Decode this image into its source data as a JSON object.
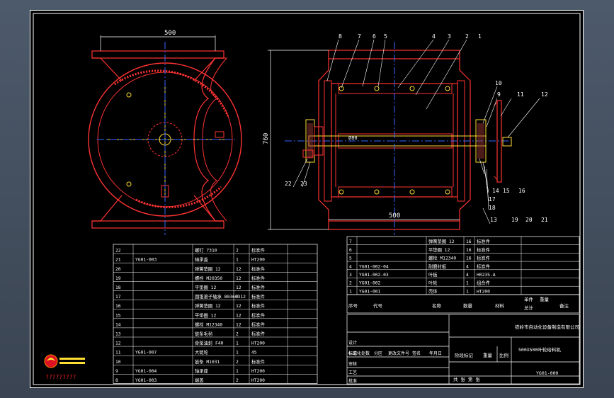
{
  "dims": {
    "width_top": "500",
    "height_left": "760",
    "width_bottom": "500",
    "shaft": "Ø80"
  },
  "balloons": [
    "8",
    "7",
    "6",
    "5",
    "4",
    "3",
    "2",
    "1",
    "10",
    "9",
    "11",
    "12",
    "13",
    "14",
    "15",
    "16",
    "17",
    "18",
    "19",
    "20",
    "21",
    "22",
    "23"
  ],
  "parts_left": [
    {
      "no": "22",
      "code": "",
      "name": "螺钉 7310",
      "qty": "2",
      "mat": "标准件"
    },
    {
      "no": "21",
      "code": "YG01-003",
      "name": "轴承盖",
      "qty": "1",
      "mat": "HT200"
    },
    {
      "no": "20",
      "code": "",
      "name": "弹簧垫圈 12",
      "qty": "12",
      "mat": "标准件"
    },
    {
      "no": "19",
      "code": "",
      "name": "螺栓 M20350",
      "qty": "12",
      "mat": "标准件"
    },
    {
      "no": "18",
      "code": "",
      "name": "平垫圈 12",
      "qty": "12",
      "mat": "标准件"
    },
    {
      "no": "17",
      "code": "",
      "name": "圆锥滚子轴承 80360312",
      "qty": "2",
      "mat": "标准件"
    },
    {
      "no": "16",
      "code": "",
      "name": "弹簧垫圈 12",
      "qty": "12",
      "mat": "标准件"
    },
    {
      "no": "15",
      "code": "",
      "name": "平垫圈 12",
      "qty": "12",
      "mat": "标准件"
    },
    {
      "no": "14",
      "code": "",
      "name": "螺栓 M12340",
      "qty": "12",
      "mat": "标准件"
    },
    {
      "no": "13",
      "code": "",
      "name": "链条毛毡",
      "qty": "2",
      "mat": "标准件"
    },
    {
      "no": "12",
      "code": "",
      "name": "骨架油封 F40",
      "qty": "1",
      "mat": "HT200"
    },
    {
      "no": "11",
      "code": "YG01-007",
      "name": "大链轮",
      "qty": "1",
      "mat": "45"
    },
    {
      "no": "10",
      "code": "",
      "name": "链条 M1031",
      "qty": "2",
      "mat": "标准件"
    },
    {
      "no": "9",
      "code": "YG01-004",
      "name": "轴承座",
      "qty": "1",
      "mat": "HT200"
    },
    {
      "no": "8",
      "code": "YG01-003",
      "name": "端盖",
      "qty": "2",
      "mat": "HT200"
    }
  ],
  "parts_right": [
    {
      "no": "7",
      "code": "",
      "name": "弹簧垫圈 12",
      "qty": "16",
      "mat": "标准件"
    },
    {
      "no": "6",
      "code": "",
      "name": "平垫圈 12",
      "qty": "16",
      "mat": "标准件"
    },
    {
      "no": "5",
      "code": "",
      "name": "螺栓 M12340",
      "qty": "16",
      "mat": "标准件"
    },
    {
      "no": "4",
      "code": "YG01-002-04",
      "name": "耐磨衬板",
      "qty": "4",
      "mat": "标准件"
    },
    {
      "no": "3",
      "code": "YG01-002-03",
      "name": "叶板",
      "qty": "4",
      "mat": "H0235-A"
    },
    {
      "no": "2",
      "code": "YG01-002",
      "name": "叶轮",
      "qty": "1",
      "mat": "组合件"
    },
    {
      "no": "1",
      "code": "YG01-001",
      "name": "壳体",
      "qty": "1",
      "mat": "HT200"
    }
  ],
  "headers": {
    "no": "序号",
    "code": "代号",
    "name": "名称",
    "qty": "数量",
    "mat": "材料",
    "single": "单件",
    "total": "总计",
    "weight": "重量",
    "remark": "备注"
  },
  "title_block": {
    "company": "铁岭市自动化设备制造有限公司",
    "drawing_title": "500X500叶轮给料机",
    "drawing_no": "YG01-000",
    "stage": "阶段标记",
    "weight": "重量",
    "scale": "比例",
    "sheets": "共  张  第  张",
    "row_labels": [
      "标记",
      "处数",
      "分区",
      "更改文件号",
      "签名",
      "年月日"
    ],
    "roles": [
      "设计",
      "标准化",
      "审核",
      "工艺",
      "批准"
    ]
  },
  "logo_text": "?????????"
}
